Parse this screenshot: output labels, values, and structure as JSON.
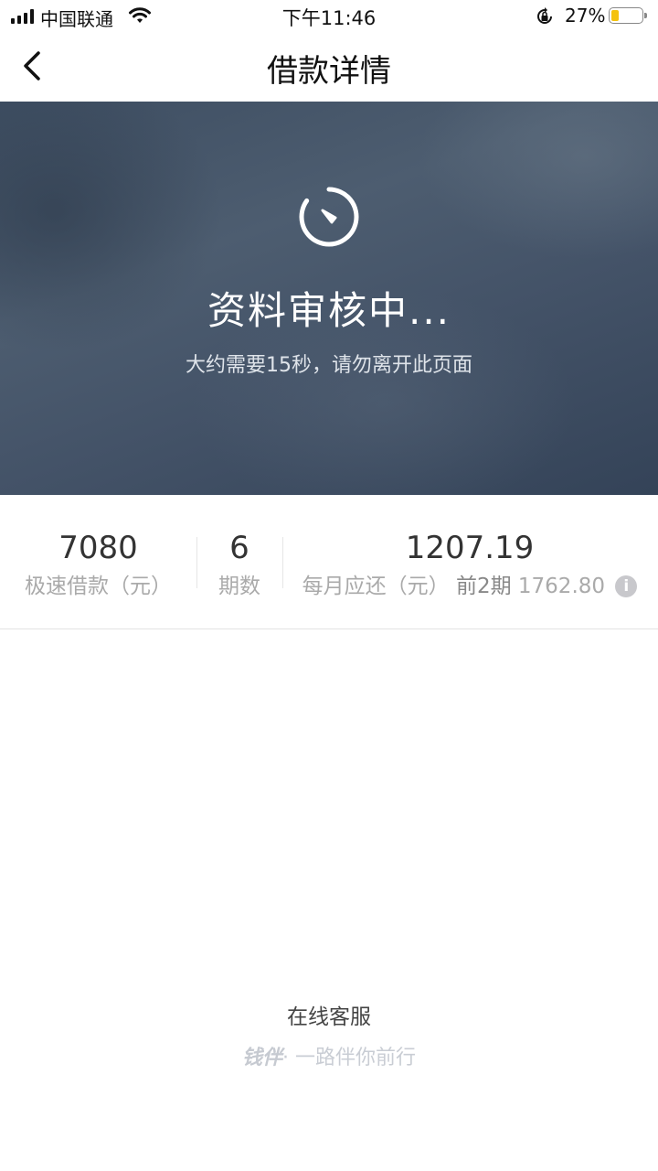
{
  "status_bar": {
    "carrier": "中国联通",
    "time": "下午11:46",
    "battery_percent": "27%",
    "battery_level": 0.27,
    "battery_color": "#f4c20d"
  },
  "nav": {
    "back_icon": "chevron-left-icon",
    "title": "借款详情"
  },
  "hero": {
    "icon": "progress-clock-icon",
    "title": "资料审核中...",
    "subtitle": "大约需要15秒，请勿离开此页面"
  },
  "summary": {
    "amount": {
      "value": "7080",
      "label": "极速借款（元）"
    },
    "term": {
      "value": "6",
      "label": "期数"
    },
    "monthly": {
      "value": "1207.19",
      "label": "每月应还（元）",
      "early_label": "前2期",
      "early_value": "1762.80",
      "info_icon": "info-icon"
    }
  },
  "footer": {
    "service_link": "在线客服",
    "brand": "钱伴",
    "slogan": "· 一路伴你前行"
  }
}
